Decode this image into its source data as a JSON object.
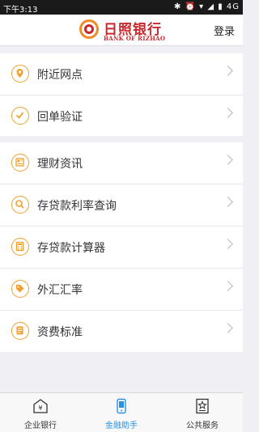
{
  "status": {
    "time": "下午3:13",
    "icons": "✱ ⏰ ▾ ◢ ▮ 4G"
  },
  "header": {
    "brand_cn": "日照银行",
    "brand_en": "BANK OF RIZHAO",
    "login": "登录"
  },
  "group1": [
    {
      "label": "附近网点",
      "icon": "location-pin-icon"
    },
    {
      "label": "回单验证",
      "icon": "checkmark-icon"
    }
  ],
  "group2": [
    {
      "label": "理财资讯",
      "icon": "news-icon"
    },
    {
      "label": "存贷款利率查询",
      "icon": "search-icon"
    },
    {
      "label": "存贷款计算器",
      "icon": "calculator-icon"
    },
    {
      "label": "外汇汇率",
      "icon": "tag-icon"
    },
    {
      "label": "资费标准",
      "icon": "document-icon"
    }
  ],
  "tabs": [
    {
      "label": "企业银行",
      "icon": "bank-icon",
      "active": false
    },
    {
      "label": "金融助手",
      "icon": "phone-icon",
      "active": true
    },
    {
      "label": "公共服务",
      "icon": "star-doc-icon",
      "active": false
    }
  ],
  "colors": {
    "accent": "#f0a030",
    "brand": "#c8282d",
    "active_tab": "#2c8fe0"
  }
}
